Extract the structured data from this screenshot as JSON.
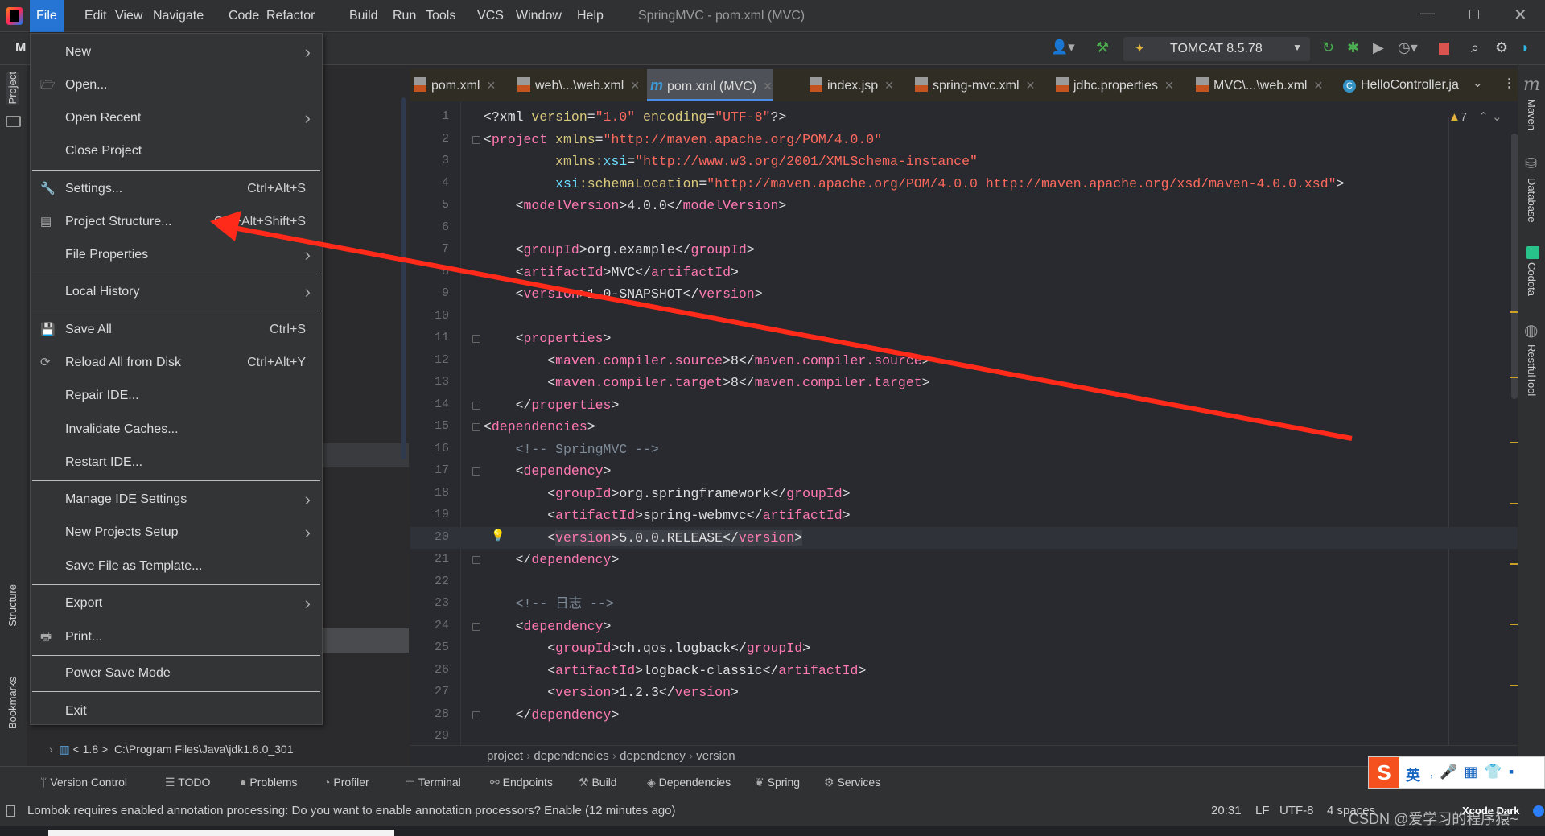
{
  "window": {
    "title": "SpringMVC - pom.xml (MVC)"
  },
  "menubar": [
    "File",
    "Edit",
    "View",
    "Navigate",
    "Code",
    "Refactor",
    "Build",
    "Run",
    "Tools",
    "VCS",
    "Window",
    "Help"
  ],
  "toolbar": {
    "project": "M",
    "run_config": "TOMCAT 8.5.78"
  },
  "left_strip": [
    "Project",
    "Structure",
    "Bookmarks"
  ],
  "right_strip": [
    "Maven",
    "Database",
    "Codota",
    "RestfulTool"
  ],
  "tabs": [
    {
      "label": "pom.xml"
    },
    {
      "label": "web\\...\\web.xml"
    },
    {
      "label": "pom.xml (MVC)",
      "active": true
    },
    {
      "label": "index.jsp"
    },
    {
      "label": "spring-mvc.xml"
    },
    {
      "label": "jdbc.properties"
    },
    {
      "label": "MVC\\...\\web.xml"
    },
    {
      "label": "HelloController.ja"
    }
  ],
  "file_menu": [
    {
      "label": "New",
      "submenu": true
    },
    {
      "label": "Open...",
      "icon": "folder-open-icon"
    },
    {
      "label": "Open Recent",
      "submenu": true
    },
    {
      "label": "Close Project",
      "sep_after": true
    },
    {
      "label": "Settings...",
      "shortcut": "Ctrl+Alt+S",
      "icon": "wrench-icon"
    },
    {
      "label": "Project Structure...",
      "shortcut": "Ctrl+Alt+Shift+S",
      "icon": "project-structure-icon"
    },
    {
      "label": "File Properties",
      "submenu": true,
      "sep_after": true
    },
    {
      "label": "Local History",
      "submenu": true,
      "sep_after": true
    },
    {
      "label": "Save All",
      "shortcut": "Ctrl+S",
      "icon": "save-icon"
    },
    {
      "label": "Reload All from Disk",
      "shortcut": "Ctrl+Alt+Y",
      "icon": "reload-icon"
    },
    {
      "label": "Repair IDE..."
    },
    {
      "label": "Invalidate Caches..."
    },
    {
      "label": "Restart IDE...",
      "sep_after": true
    },
    {
      "label": "Manage IDE Settings",
      "submenu": true
    },
    {
      "label": "New Projects Setup",
      "submenu": true
    },
    {
      "label": "Save File as Template...",
      "sep_after": true
    },
    {
      "label": "Export",
      "submenu": true
    },
    {
      "label": "Print...",
      "icon": "print-icon",
      "sep_after": true
    },
    {
      "label": "Power Save Mode",
      "sep_after": true
    },
    {
      "label": "Exit"
    }
  ],
  "project_panel": {
    "sdk_row": "< 1.8 >  C:\\Program Files\\Java\\jdk1.8.0_301"
  },
  "editor": {
    "warnings": "7",
    "current_line": 20,
    "lines": [
      [
        [
          "p",
          "<?xml"
        ],
        [
          "a",
          " version"
        ],
        [
          "p",
          "="
        ],
        [
          "s",
          "\"1.0\""
        ],
        [
          "a",
          " encoding"
        ],
        [
          "p",
          "="
        ],
        [
          "s",
          "\"UTF-8\""
        ],
        [
          "p",
          "?>"
        ]
      ],
      [
        [
          "p",
          "<"
        ],
        [
          "t",
          "project"
        ],
        [
          "a",
          " xmlns"
        ],
        [
          "p",
          "="
        ],
        [
          "s",
          "\"http://maven.apache.org/POM/4.0.0\""
        ]
      ],
      [
        [
          "p",
          "         "
        ],
        [
          "a",
          "xmlns:"
        ],
        [
          "n",
          "xsi"
        ],
        [
          "p",
          "="
        ],
        [
          "s",
          "\"http://www.w3.org/2001/XMLSchema-instance\""
        ]
      ],
      [
        [
          "p",
          "         "
        ],
        [
          "n",
          "xsi"
        ],
        [
          "a",
          ":schemaLocation"
        ],
        [
          "p",
          "="
        ],
        [
          "s",
          "\"http://maven.apache.org/POM/4.0.0 http://maven.apache.org/xsd/maven-4.0.0.xsd\""
        ],
        [
          "p",
          ">"
        ]
      ],
      [
        [
          "p",
          "    <"
        ],
        [
          "t",
          "modelVersion"
        ],
        [
          "p",
          ">"
        ],
        [
          "x",
          "4.0.0"
        ],
        [
          "p",
          "</"
        ],
        [
          "t",
          "modelVersion"
        ],
        [
          "p",
          ">"
        ]
      ],
      [],
      [
        [
          "p",
          "    <"
        ],
        [
          "t",
          "groupId"
        ],
        [
          "p",
          ">"
        ],
        [
          "x",
          "org.example"
        ],
        [
          "p",
          "</"
        ],
        [
          "t",
          "groupId"
        ],
        [
          "p",
          ">"
        ]
      ],
      [
        [
          "p",
          "    <"
        ],
        [
          "t",
          "artifactId"
        ],
        [
          "p",
          ">"
        ],
        [
          "x",
          "MVC"
        ],
        [
          "p",
          "</"
        ],
        [
          "t",
          "artifactId"
        ],
        [
          "p",
          ">"
        ]
      ],
      [
        [
          "p",
          "    <"
        ],
        [
          "t",
          "version"
        ],
        [
          "p",
          ">"
        ],
        [
          "x",
          "1.0-SNAPSHOT"
        ],
        [
          "p",
          "</"
        ],
        [
          "t",
          "version"
        ],
        [
          "p",
          ">"
        ]
      ],
      [],
      [
        [
          "p",
          "    <"
        ],
        [
          "t",
          "properties"
        ],
        [
          "p",
          ">"
        ]
      ],
      [
        [
          "p",
          "        <"
        ],
        [
          "t",
          "maven.compiler.source"
        ],
        [
          "p",
          ">"
        ],
        [
          "x",
          "8"
        ],
        [
          "p",
          "</"
        ],
        [
          "t",
          "maven.compiler.source"
        ],
        [
          "p",
          ">"
        ]
      ],
      [
        [
          "p",
          "        <"
        ],
        [
          "t",
          "maven.compiler.target"
        ],
        [
          "p",
          ">"
        ],
        [
          "x",
          "8"
        ],
        [
          "p",
          "</"
        ],
        [
          "t",
          "maven.compiler.target"
        ],
        [
          "p",
          ">"
        ]
      ],
      [
        [
          "p",
          "    </"
        ],
        [
          "t",
          "properties"
        ],
        [
          "p",
          ">"
        ]
      ],
      [
        [
          "p",
          "<"
        ],
        [
          "t",
          "dependencies"
        ],
        [
          "p",
          ">"
        ]
      ],
      [
        [
          "c",
          "    <!-- SpringMVC -->"
        ]
      ],
      [
        [
          "p",
          "    <"
        ],
        [
          "t",
          "dependency"
        ],
        [
          "p",
          ">"
        ]
      ],
      [
        [
          "p",
          "        <"
        ],
        [
          "t",
          "groupId"
        ],
        [
          "p",
          ">"
        ],
        [
          "x",
          "org.springframework"
        ],
        [
          "p",
          "</"
        ],
        [
          "t",
          "groupId"
        ],
        [
          "p",
          ">"
        ]
      ],
      [
        [
          "p",
          "        <"
        ],
        [
          "t",
          "artifactId"
        ],
        [
          "p",
          ">"
        ],
        [
          "x",
          "spring-webmvc"
        ],
        [
          "p",
          "</"
        ],
        [
          "t",
          "artifactId"
        ],
        [
          "p",
          ">"
        ]
      ],
      [
        [
          "p",
          "        <"
        ],
        [
          "t",
          "version"
        ],
        [
          "p",
          ">"
        ],
        [
          "x",
          "5.0.0.RELEASE"
        ],
        [
          "p",
          "</"
        ],
        [
          "t",
          "version"
        ],
        [
          "p",
          ">"
        ]
      ],
      [
        [
          "p",
          "    </"
        ],
        [
          "t",
          "dependency"
        ],
        [
          "p",
          ">"
        ]
      ],
      [],
      [
        [
          "c",
          "    <!-- 日志 -->"
        ]
      ],
      [
        [
          "p",
          "    <"
        ],
        [
          "t",
          "dependency"
        ],
        [
          "p",
          ">"
        ]
      ],
      [
        [
          "p",
          "        <"
        ],
        [
          "t",
          "groupId"
        ],
        [
          "p",
          ">"
        ],
        [
          "x",
          "ch.qos.logback"
        ],
        [
          "p",
          "</"
        ],
        [
          "t",
          "groupId"
        ],
        [
          "p",
          ">"
        ]
      ],
      [
        [
          "p",
          "        <"
        ],
        [
          "t",
          "artifactId"
        ],
        [
          "p",
          ">"
        ],
        [
          "x",
          "logback-classic"
        ],
        [
          "p",
          "</"
        ],
        [
          "t",
          "artifactId"
        ],
        [
          "p",
          ">"
        ]
      ],
      [
        [
          "p",
          "        <"
        ],
        [
          "t",
          "version"
        ],
        [
          "p",
          ">"
        ],
        [
          "x",
          "1.2.3"
        ],
        [
          "p",
          "</"
        ],
        [
          "t",
          "version"
        ],
        [
          "p",
          ">"
        ]
      ],
      [
        [
          "p",
          "    </"
        ],
        [
          "t",
          "dependency"
        ],
        [
          "p",
          ">"
        ]
      ],
      []
    ],
    "fold_lines": [
      2,
      11,
      14,
      15,
      17,
      21,
      24,
      28
    ]
  },
  "breadcrumb": [
    "project",
    "dependencies",
    "dependency",
    "version"
  ],
  "tool_windows": [
    "Version Control",
    "TODO",
    "Problems",
    "Profiler",
    "Terminal",
    "Endpoints",
    "Build",
    "Dependencies",
    "Spring",
    "Services"
  ],
  "status": {
    "message": "Lombok requires enabled annotation processing: Do you want to enable annotation processors? Enable (12 minutes ago)",
    "position": "20:31",
    "line_sep": "LF",
    "encoding": "UTF-8",
    "indent": "4 spaces",
    "theme": "Xcode Dark"
  },
  "watermark": "CSDN @爱学习的程序猿~",
  "ime": {
    "mode": "英"
  },
  "colors": {
    "accent": "#2675d4",
    "annotation_arrow": "#ff2a1a",
    "warning": "#c9a227"
  }
}
